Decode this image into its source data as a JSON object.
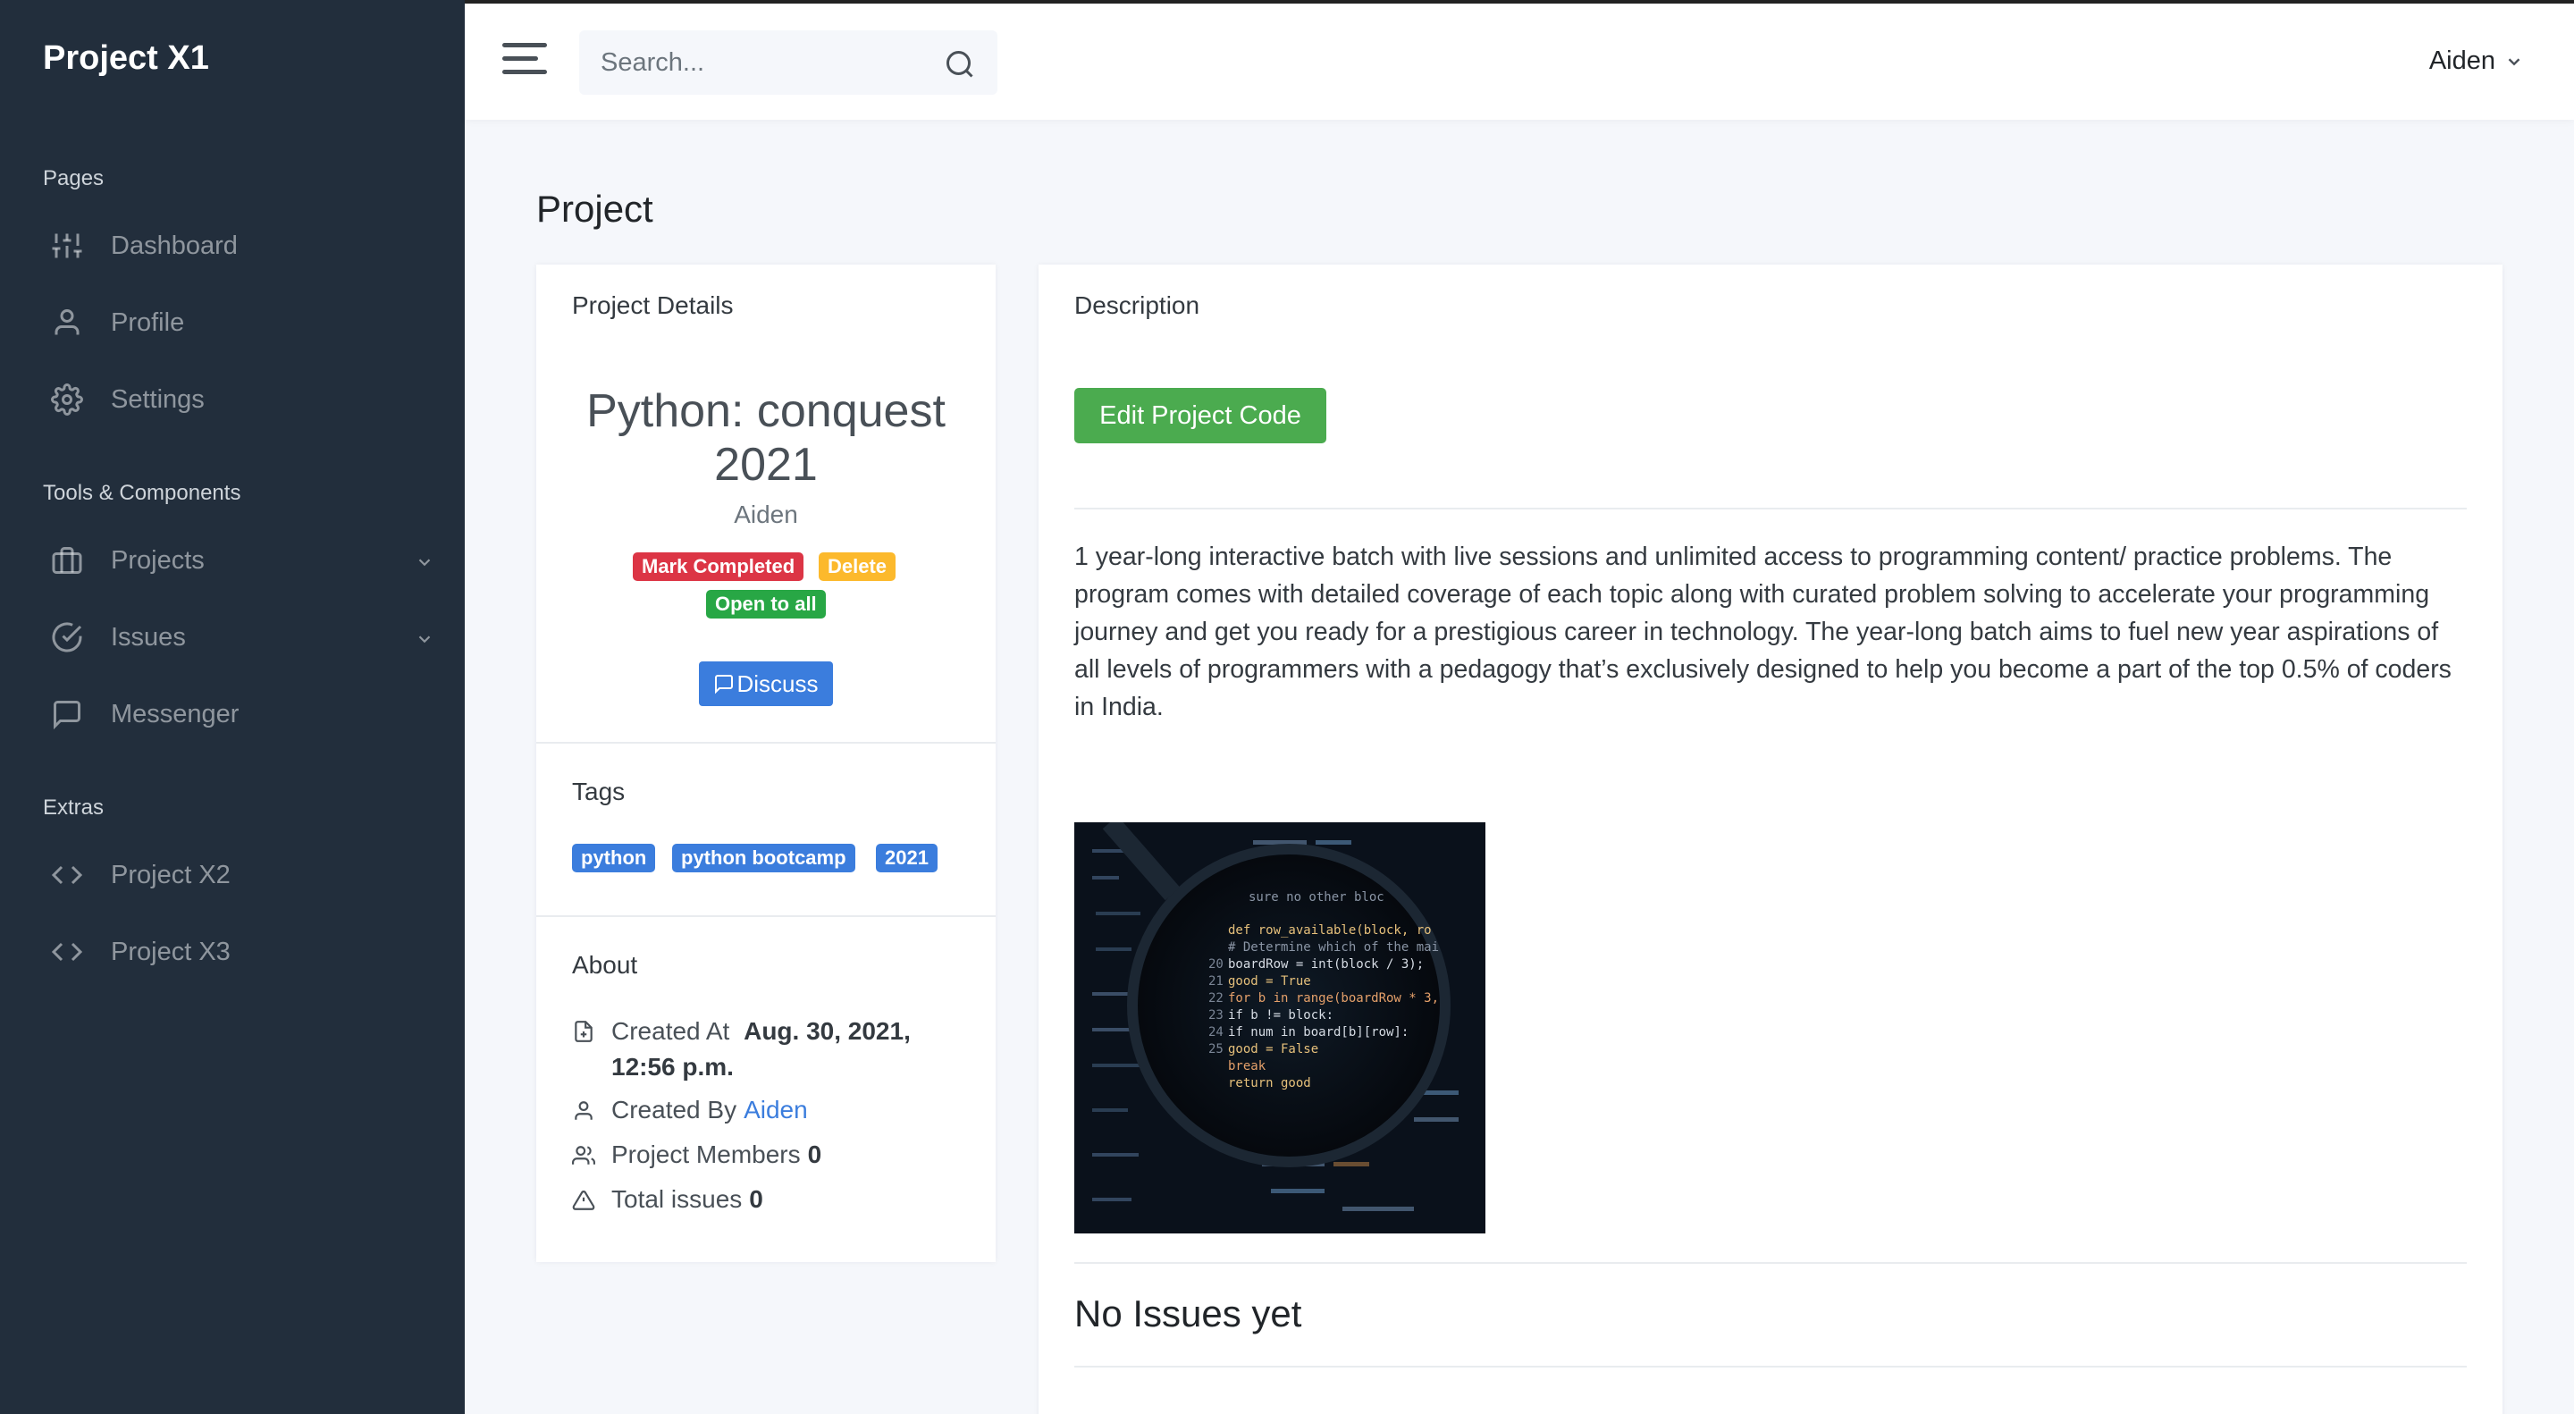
{
  "sidebar": {
    "brand": "Project X1",
    "sections": {
      "pages": "Pages",
      "tools": "Tools & Components",
      "extras": "Extras"
    },
    "items": [
      {
        "label": "Dashboard",
        "icon": "sliders-icon"
      },
      {
        "label": "Profile",
        "icon": "user-icon"
      },
      {
        "label": "Settings",
        "icon": "gear-icon"
      },
      {
        "label": "Projects",
        "icon": "briefcase-icon"
      },
      {
        "label": "Issues",
        "icon": "check-circle-icon"
      },
      {
        "label": "Messenger",
        "icon": "message-square-icon"
      },
      {
        "label": "Project X2",
        "icon": "code-icon"
      },
      {
        "label": "Project X3",
        "icon": "code-icon"
      }
    ]
  },
  "topbar": {
    "search_placeholder": "Search...",
    "user": "Aiden"
  },
  "page": {
    "title": "Project"
  },
  "project_details": {
    "header": "Project Details",
    "name": "Python: conquest 2021",
    "owner": "Aiden",
    "badges": {
      "mark_completed": "Mark Completed",
      "delete": "Delete",
      "open_to_all": "Open to all"
    },
    "discuss": "Discuss"
  },
  "tags": {
    "header": "Tags",
    "items": [
      "python",
      "python bootcamp",
      "2021"
    ]
  },
  "about": {
    "header": "About",
    "created_at_label": "Created At",
    "created_at_value": "Aug. 30, 2021, 12:56 p.m.",
    "created_by_label": "Created By",
    "created_by_value": "Aiden",
    "members_label": "Project Members",
    "members_value": "0",
    "issues_label": "Total issues",
    "issues_value": "0"
  },
  "description": {
    "header": "Description",
    "edit_button": "Edit Project Code",
    "text": "1 year-long interactive batch with live sessions and unlimited access to programming content/ practice problems. The program comes with detailed coverage of each topic along with curated problem solving to accelerate your programming journey and get you ready for a prestigious career in technology. The year-long batch aims to fuel new year aspirations of all levels of programmers with a pedagogy that’s exclusively designed to help you become a part of the top 0.5% of coders in India.",
    "code_lines": [
      "sure no other bloc",
      "def row_available(block, ro",
      "# Determine which of the mai",
      "boardRow = int(block / 3);",
      "good = True",
      "for b in range(boardRow * 3,",
      "if b != block:",
      "if num in board[b][row]:",
      "good = False",
      "break",
      "return good"
    ],
    "line_numbers": [
      "20",
      "21",
      "22",
      "23",
      "24",
      "25"
    ],
    "no_issues": "No Issues yet"
  },
  "colors": {
    "sidebar_bg": "#222e3c",
    "primary": "#3b7ddd",
    "success": "#4bab4f",
    "danger": "#dc3545",
    "warning": "#fcb92c"
  }
}
